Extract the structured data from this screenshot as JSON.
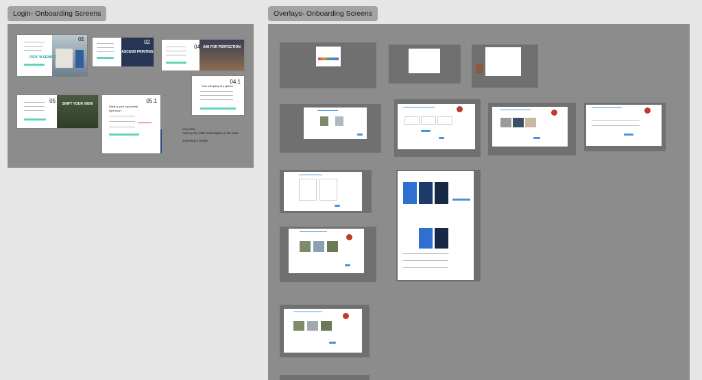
{
  "sections": {
    "login": {
      "title": "Login- Onboarding Screens"
    },
    "overlays": {
      "title": "Overlays- Onboarding Screens"
    }
  },
  "login_screens": [
    {
      "number": "01",
      "photo_text": "PICK 'N SEND IT"
    },
    {
      "number": "02",
      "photo_text": "ASCEND PRINTING"
    },
    {
      "number": "04",
      "photo_text": "AIM FOR PERFECTION",
      "headline": "Your company at a glance"
    },
    {
      "number": "04.1"
    },
    {
      "number": "05",
      "photo_text": "SHIFT YOUR VIEW"
    },
    {
      "number": "05.1",
      "headline": "What is your top priority right now?"
    }
  ],
  "notes": {
    "line1": "very slow",
    "line2": "remove the SMS subscription in the start",
    "line3": "Just keep it simple"
  },
  "colors": {
    "accent_teal": "#5fd3bd",
    "accent_blue": "#4a90e2",
    "brand_red": "#c0392b"
  }
}
